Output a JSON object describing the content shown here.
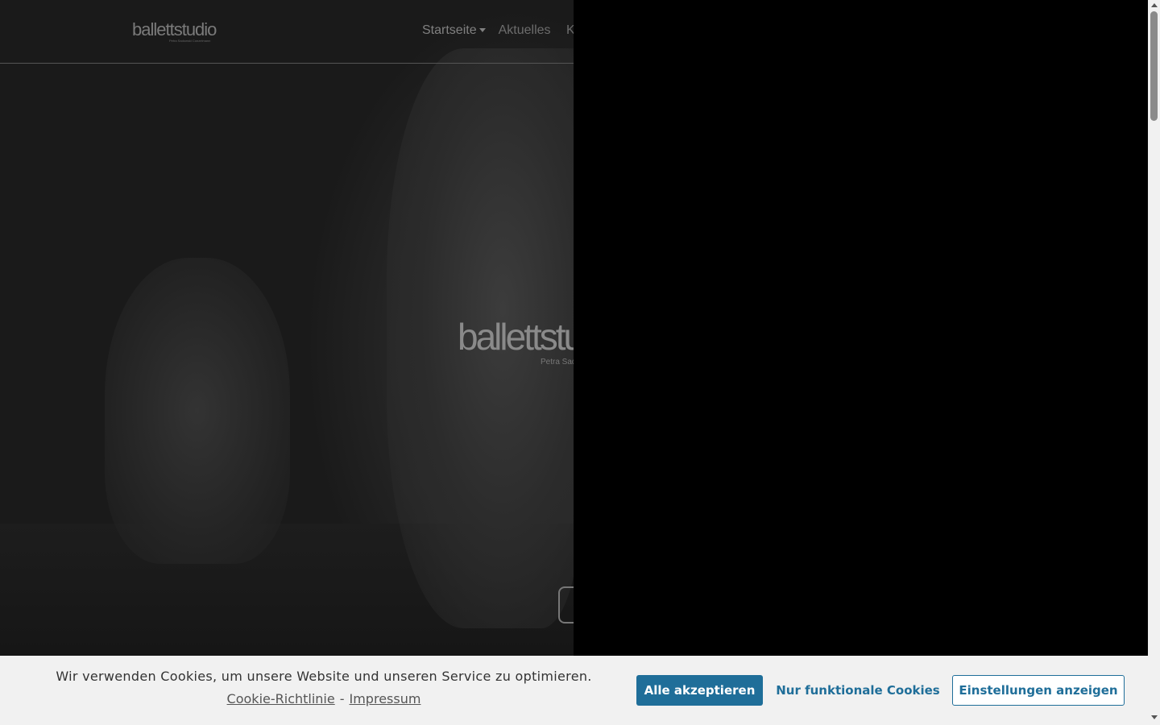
{
  "header": {
    "logo_text": "ballettstudio",
    "logo_subtitle": "Petra Sadowski Conzelmann",
    "nav": [
      {
        "label": "Startseite"
      },
      {
        "label": "Aktuelles"
      },
      {
        "label": "K"
      }
    ]
  },
  "hero": {
    "logo_text": "ballettstu",
    "logo_subtitle": "Petra Sad"
  },
  "cookie_banner": {
    "message": "Wir verwenden Cookies, um unsere Website und unseren Service zu optimieren.",
    "policy_link": "Cookie-Richtlinie",
    "separator": "-",
    "imprint_link": "Impressum",
    "accept_all": "Alle akzeptieren",
    "functional_only": "Nur funktionale Cookies",
    "show_settings": "Einstellungen anzeigen",
    "accent_color": "#1f6e99"
  }
}
